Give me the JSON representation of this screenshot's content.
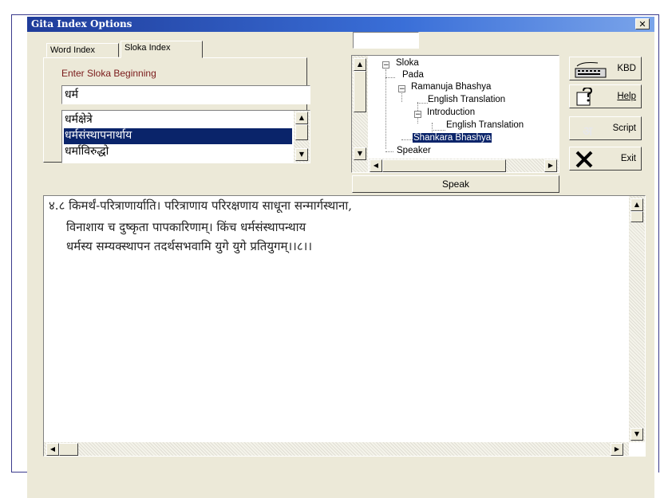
{
  "window": {
    "title": "Gita Index Options",
    "close_label": "✕"
  },
  "tabs": [
    {
      "label": "Word Index"
    },
    {
      "label": "Sloka Index"
    }
  ],
  "top_input": {
    "value": ""
  },
  "sloka_panel": {
    "prompt": "Enter Sloka Beginning",
    "input_value": "धर्म",
    "list": [
      {
        "text": "धर्मक्षेत्रे",
        "selected": false
      },
      {
        "text": "धर्मसंस्थापनार्थाय",
        "selected": true
      },
      {
        "text": "धर्माविरुद्धो",
        "selected": false
      }
    ]
  },
  "tree": {
    "items": [
      {
        "label": "Sloka"
      },
      {
        "label": "Pada"
      },
      {
        "label": "Ramanuja Bhashya"
      },
      {
        "label": "English Translation"
      },
      {
        "label": "Introduction"
      },
      {
        "label": "English Translation"
      },
      {
        "label": "Shankara Bhashya"
      },
      {
        "label": "Speaker"
      }
    ],
    "selected": "Shankara Bhashya"
  },
  "buttons": {
    "kbd": "KBD",
    "help": "Help",
    "script": "Script",
    "exit": "Exit",
    "speak": "Speak"
  },
  "text_content": {
    "lines": [
      "४.८ किमर्थं-परित्राणार्याति। परित्राणाय परिरक्षणाय साधूना सन्मार्गस्थाना,",
      "विनाशाय च दुष्कृता पापकारिणाम्। किंच धर्मसंस्थापन्थाय",
      "धर्मस्य सम्यक्स्थापन तदर्थसभवामि युगे युगे प्रतियुगम्।।८।।"
    ]
  },
  "colors": {
    "title_bar": "#1f3c9a",
    "selection": "#0a246a",
    "prompt_text": "#7a1a1a",
    "window_bg": "#ece9d8"
  }
}
